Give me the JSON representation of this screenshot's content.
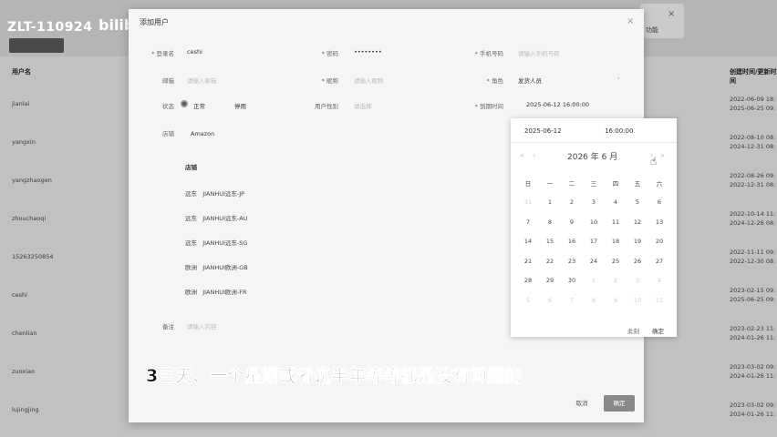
{
  "background": {
    "column_header_left": "用户名",
    "column_header_right": "创建时间/更新时间",
    "notice_text": "功能",
    "rows": [
      {
        "name": "jianlai",
        "date1": "2022-06-09 18:",
        "date2": "2025-06-25 09:"
      },
      {
        "name": "yangxin",
        "date1": "2022-08-10 08:",
        "date2": "2024-12-31 08:"
      },
      {
        "name": "yangzhaogen",
        "date1": "2022-08-26 09:",
        "date2": "2022-12-31 08:"
      },
      {
        "name": "zhouchaoqi",
        "date1": "2022-10-14 11:",
        "date2": "2024-12-26 08:"
      },
      {
        "name": "15263250854",
        "date1": "2022-11-11 09:",
        "date2": "2022-12-30 08:"
      },
      {
        "name": "ceshi",
        "date1": "2023-02-15 09:",
        "date2": "2025-06-25 09:"
      },
      {
        "name": "chenlian",
        "date1": "2023-02-23 11:",
        "date2": "2024-01-26 11:"
      },
      {
        "name": "zuoxiao",
        "date1": "2023-03-02 09:",
        "date2": "2024-01-26 11:"
      },
      {
        "name": "lujingjing",
        "date1": "2023-03-02 09:",
        "date2": "2024-01-26 11:"
      }
    ]
  },
  "watermark": {
    "user": "ZLT-110924",
    "logo": "bilibili"
  },
  "modal": {
    "title": "添加用户",
    "close_icon": "×",
    "fields": {
      "login_name": {
        "label": "* 登录名",
        "value": "ceshi"
      },
      "password": {
        "label": "* 密码",
        "value": "••••••••"
      },
      "phone": {
        "label": "* 手机号码",
        "placeholder": "请输入手机号码"
      },
      "email": {
        "label": "邮箱",
        "placeholder": "请输入邮箱"
      },
      "nickname": {
        "label": "* 昵称",
        "placeholder": "请输入昵称"
      },
      "role": {
        "label": "* 角色",
        "value": "发货人员"
      },
      "status": {
        "label": "状态",
        "option_on": "正常",
        "option_off": "停用"
      },
      "gender": {
        "label": "用户性别",
        "placeholder": "请选择"
      },
      "expire": {
        "label": "* 到期时间",
        "value": "2025-06-12 16:00:00"
      },
      "shop": {
        "label": "店铺",
        "value": "Amazon"
      },
      "remark": {
        "label": "备注",
        "placeholder": "请输入内容"
      }
    },
    "shop_list": {
      "header": "店铺",
      "items": [
        "远东   JIANHUI远东-JP",
        "远东   JIANHUI远东-AU",
        "远东   JIANHUI远东-SG",
        "欧洲   JIANHUI欧洲-GB",
        "欧洲   JIANHUI欧洲-FR"
      ]
    },
    "buttons": {
      "cancel": "取消",
      "ok": "确定"
    }
  },
  "datepicker": {
    "date_value": "2025-06-12",
    "time_value": "16:00:00",
    "header": "2026 年  6 月",
    "nav_prev_year": "«",
    "nav_prev_month": "‹",
    "nav_next_month": "›",
    "nav_next_year": "»",
    "weekdays": [
      "日",
      "一",
      "二",
      "三",
      "四",
      "五",
      "六"
    ],
    "weeks": [
      [
        "31",
        "1",
        "2",
        "3",
        "4",
        "5",
        "6"
      ],
      [
        "7",
        "8",
        "9",
        "10",
        "11",
        "12",
        "13"
      ],
      [
        "14",
        "15",
        "16",
        "17",
        "18",
        "19",
        "20"
      ],
      [
        "21",
        "22",
        "23",
        "24",
        "25",
        "26",
        "27"
      ],
      [
        "28",
        "29",
        "30",
        "1",
        "2",
        "3",
        "4"
      ],
      [
        "5",
        "6",
        "7",
        "8",
        "9",
        "10",
        "11"
      ]
    ],
    "now_label": "此刻",
    "confirm_label": "确定"
  },
  "subtitle": "3三天、一个星期或者说半年等等都是没有问题的"
}
